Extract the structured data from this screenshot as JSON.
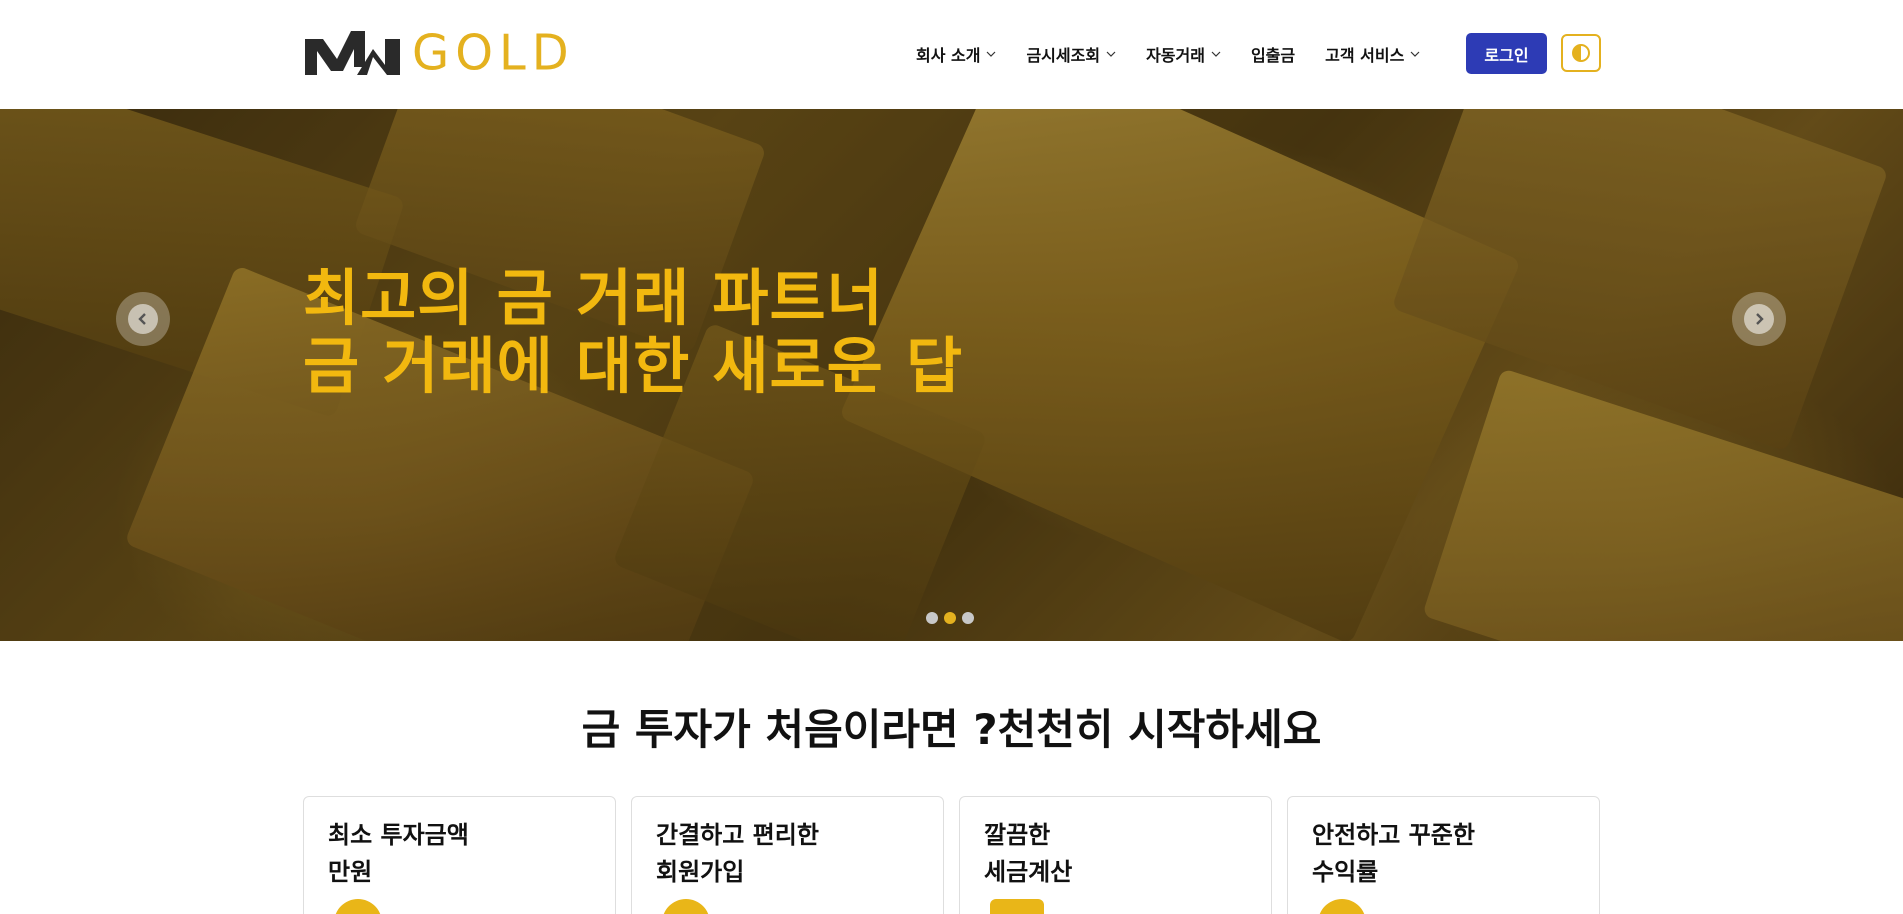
{
  "brand": {
    "logo_text": "GOLD",
    "accent_color": "#e4b11f",
    "logo_mark_color": "#2a2a2a"
  },
  "nav": {
    "items": [
      {
        "label": "회사 소개",
        "has_dropdown": true
      },
      {
        "label": "금시세조회",
        "has_dropdown": true
      },
      {
        "label": "자동거래",
        "has_dropdown": true
      },
      {
        "label": "입출금",
        "has_dropdown": false
      },
      {
        "label": "고객 서비스",
        "has_dropdown": true
      }
    ],
    "login_label": "로그인",
    "login_color": "#2d3bb5",
    "theme_toggle_icon": "contrast-icon"
  },
  "hero": {
    "title_line1": "최고의 금 거래 파트너",
    "title_line2": "금 거래에 대한 새로운 답",
    "title_color": "#f2b80f",
    "prev_icon": "chevron-left-icon",
    "next_icon": "chevron-right-icon",
    "slide_count": 3,
    "active_slide": 2
  },
  "section": {
    "title": "금 투자가 처음이라면 ?천천히 시작하세요"
  },
  "cards": [
    {
      "line1": "최소 투자금액",
      "line2": "만원",
      "icon": "coin-icon"
    },
    {
      "line1": "간결하고 편리한",
      "line2": "회원가입",
      "icon": "user-icon"
    },
    {
      "line1": "깔끔한",
      "line2": "세금계산",
      "icon": "calculator-icon"
    },
    {
      "line1": "안전하고 꾸준한",
      "line2": "수익률",
      "icon": "chart-icon"
    }
  ]
}
